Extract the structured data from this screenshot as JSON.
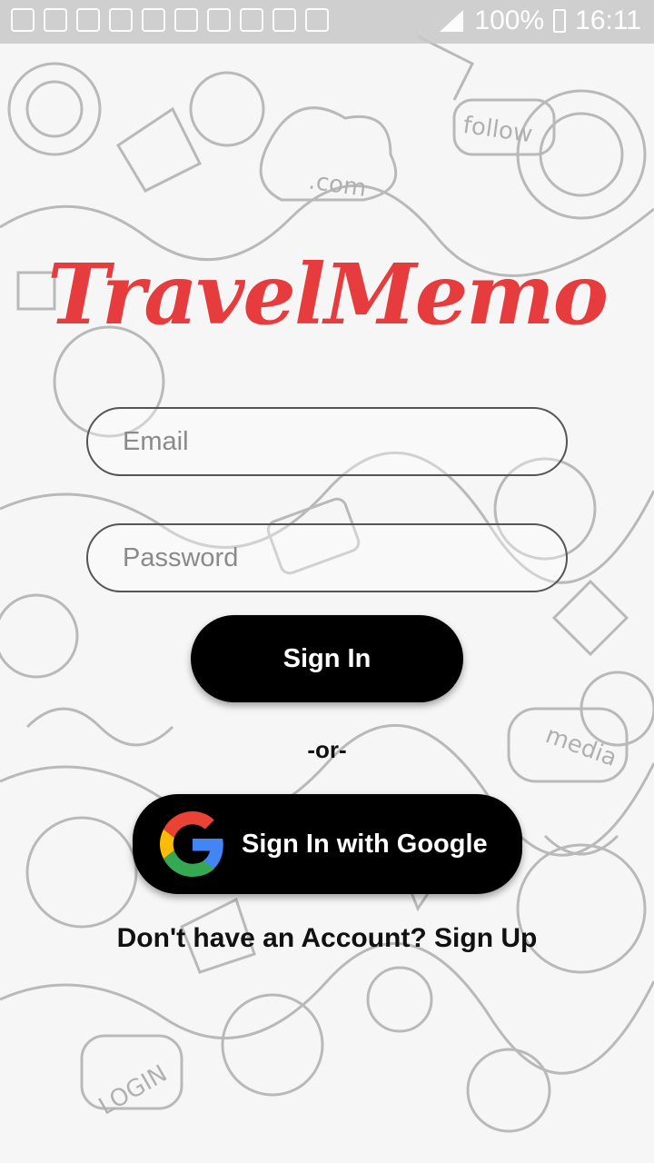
{
  "status_bar": {
    "battery": "100%",
    "time": "16:11"
  },
  "app": {
    "title": "TravelMemo",
    "accent": "#e63c3e"
  },
  "form": {
    "email_placeholder": "Email",
    "password_placeholder": "Password",
    "sign_in_label": "Sign In",
    "divider": "-or-",
    "google_label": "Sign In with Google",
    "signup_text": "Don't have an Account? Sign Up"
  }
}
